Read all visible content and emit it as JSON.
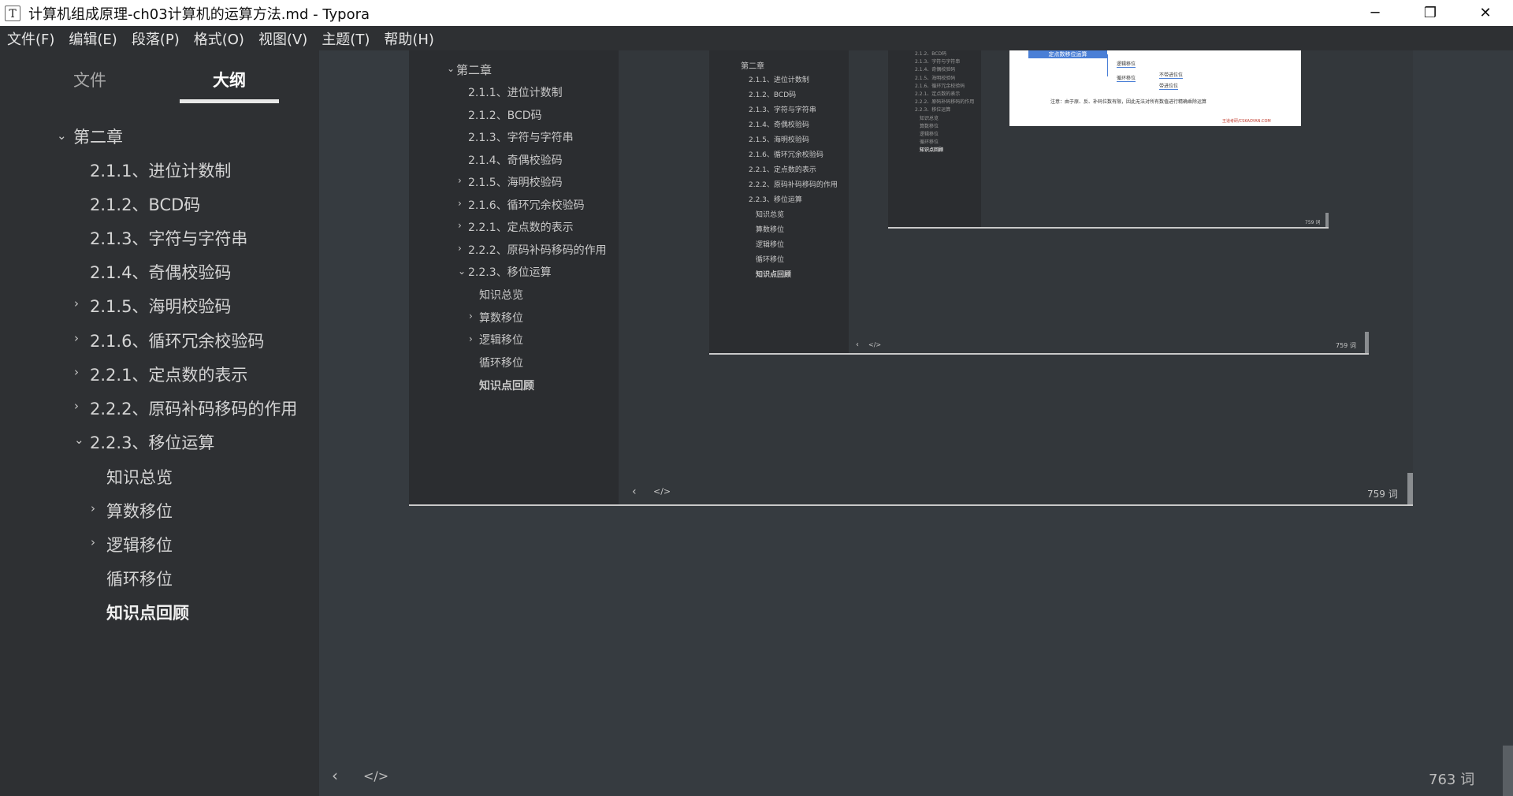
{
  "window": {
    "app_icon": "T",
    "title": "计算机组成原理-ch03计算机的运算方法.md - Typora",
    "controls": {
      "minimize": "─",
      "maximize": "❐",
      "close": "✕"
    }
  },
  "menu": [
    "文件(F)",
    "编辑(E)",
    "段落(P)",
    "格式(O)",
    "视图(V)",
    "主题(T)",
    "帮助(H)"
  ],
  "sidebar": {
    "tabs": {
      "files": "文件",
      "outline": "大纲"
    },
    "outline": [
      {
        "label": "第二章",
        "chevron": "⌄"
      },
      {
        "label": "2.1.1、进位计数制",
        "chevron": ""
      },
      {
        "label": "2.1.2、BCD码",
        "chevron": ""
      },
      {
        "label": "2.1.3、字符与字符串",
        "chevron": ""
      },
      {
        "label": "2.1.4、奇偶校验码",
        "chevron": ""
      },
      {
        "label": "2.1.5、海明校验码",
        "chevron": "›"
      },
      {
        "label": "2.1.6、循环冗余校验码",
        "chevron": "›"
      },
      {
        "label": "2.2.1、定点数的表示",
        "chevron": "›"
      },
      {
        "label": "2.2.2、原码补码移码的作用",
        "chevron": "›"
      },
      {
        "label": "2.2.3、移位运算",
        "chevron": "⌄"
      },
      {
        "label": "知识总览",
        "chevron": ""
      },
      {
        "label": "算数移位",
        "chevron": "›"
      },
      {
        "label": "逻辑移位",
        "chevron": "›"
      },
      {
        "label": "循环移位",
        "chevron": ""
      },
      {
        "label": "知识点回顾",
        "chevron": ""
      }
    ]
  },
  "editor": {
    "footer": {
      "back_icon": "‹",
      "source_icon": "</>",
      "word_count": "763 词"
    },
    "nested": [
      {
        "word_count": "759 词"
      },
      {
        "word_count": "759 词"
      },
      {
        "word_count": "759 词"
      }
    ],
    "mindmap_title": "定点数移位运算",
    "mindmap_nodes": [
      "逻辑移位",
      "循环移位",
      "不带进位位",
      "带进位位"
    ],
    "mindmap_note": "注意：由于原、反、补码位数有限，因此无法对所有数值进行精确乘除运算",
    "mindmap_watermark": "王道考研/CSKAOYAN.COM"
  }
}
